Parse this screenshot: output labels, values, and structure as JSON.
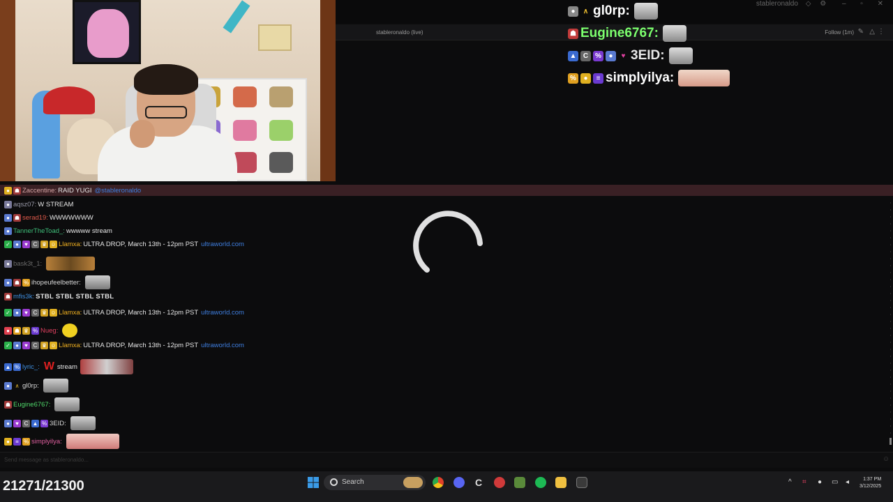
{
  "window": {
    "channel_title": "stableronaldo (live)",
    "follow_label": "Follow (1m)",
    "top_title": "stableronaldo"
  },
  "overlay_chat": [
    {
      "user": "gl0rp:",
      "color": "#ffffff"
    },
    {
      "user": "Eugine6767:",
      "color": "#7cff6e"
    },
    {
      "user": "3EID:",
      "color": "#e8e8e8"
    },
    {
      "user": "simplyilya:",
      "color": "#ffffff"
    }
  ],
  "chat": [
    {
      "user": "Zaccentine:",
      "user_color": "#d8d8d8",
      "text": "RAID YUGI",
      "mention": "@stableronaldo"
    },
    {
      "user": "aqsz07:",
      "user_color": "#d8d8d8",
      "text": "W STREAM"
    },
    {
      "user": "serad19:",
      "user_color": "#e05a4a",
      "text": "WWWWWWW"
    },
    {
      "user": "TannerTheToad_:",
      "user_color": "#3fbf7a",
      "text": "wwwww stream"
    },
    {
      "user": "Llamxa:",
      "user_color": "#f0b020",
      "text": "ULTRA DROP, March 13th - 12pm PST",
      "link": "ultraworld.com"
    },
    {
      "user": "bask3t_1:",
      "user_color": "#6a6a6a",
      "text": ""
    },
    {
      "user": "ihopeufeelbetter:",
      "user_color": "#d8d8d8",
      "text": ""
    },
    {
      "user": "mfis3k:",
      "user_color": "#3f8fe0",
      "text": "STBL STBL STBL STBL"
    },
    {
      "user": "Llamxa:",
      "user_color": "#f0b020",
      "text": "ULTRA DROP, March 13th - 12pm PST",
      "link": "ultraworld.com"
    },
    {
      "user": "Nueg:",
      "user_color": "#e04060",
      "text": ""
    },
    {
      "user": "Llamxa:",
      "user_color": "#f0b020",
      "text": "ULTRA DROP, March 13th - 12pm PST",
      "link": "ultraworld.com"
    },
    {
      "user": "lyric_:",
      "user_color": "#3f8fe0",
      "text": "stream"
    },
    {
      "user": "gl0rp:",
      "user_color": "#d8d8d8",
      "text": ""
    },
    {
      "user": "Eugine6767:",
      "user_color": "#4fd86a",
      "text": ""
    },
    {
      "user": "3EID:",
      "user_color": "#d8d8d8",
      "text": ""
    },
    {
      "user": "simplyilya:",
      "user_color": "#e060a0",
      "text": ""
    }
  ],
  "input_placeholder": "Send message as stableronaldo...",
  "counter": "21271/21300",
  "taskbar": {
    "search_label": "Search",
    "time": "1:37 PM",
    "date": "3/12/2025"
  },
  "colors": {
    "background": "#0c0c0d",
    "separator": "#3a2024",
    "accent_green": "#7cff6e",
    "link_blue": "#3f7fe0"
  },
  "icons": [
    "windows-start-icon",
    "search-icon",
    "chrome-icon",
    "discord-icon",
    "spotify-icon",
    "folder-icon",
    "loading-spinner-icon",
    "pencil-icon",
    "settings-icon"
  ]
}
